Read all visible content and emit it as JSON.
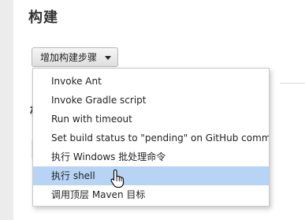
{
  "section": {
    "title": "构建",
    "obscured_heading": "构"
  },
  "add_step_button": {
    "label": "增加构建步骤"
  },
  "dropdown_menu": {
    "items": [
      {
        "label": "Invoke Ant"
      },
      {
        "label": "Invoke Gradle script"
      },
      {
        "label": "Run with timeout"
      },
      {
        "label": "Set build status to \"pending\" on GitHub commit"
      },
      {
        "label": "执行 Windows 批处理命令"
      },
      {
        "label": "执行 shell",
        "highlighted": true
      },
      {
        "label": "调用顶层 Maven 目标"
      }
    ]
  },
  "colors": {
    "highlight": "#b7d4f5",
    "page_background": "#ececec",
    "panel_background": "#ffffff"
  },
  "cursor": {
    "icon": "hand-pointer-icon"
  }
}
